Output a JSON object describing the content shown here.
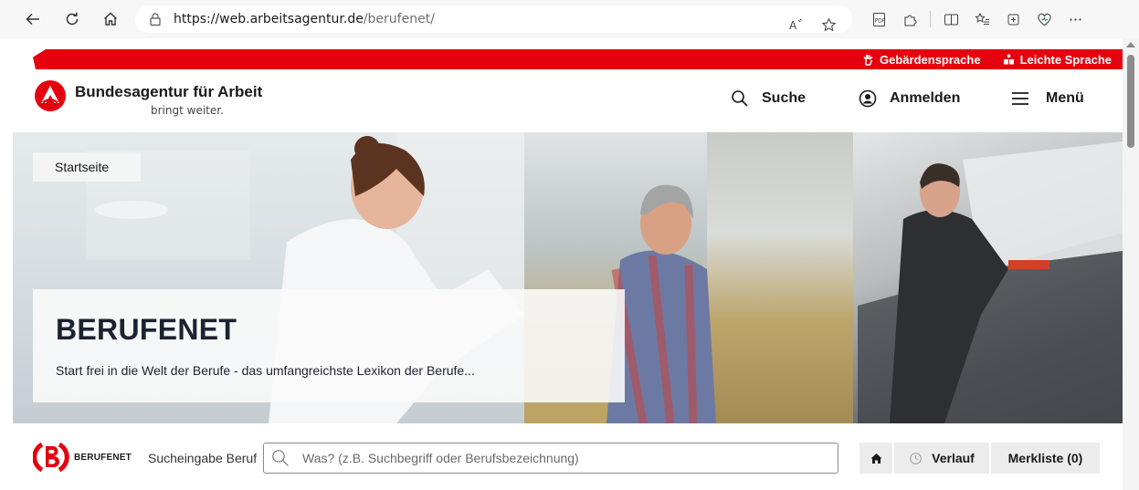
{
  "browser": {
    "url_domain": "https://web.arbeitsagentur.de",
    "url_path": "/berufenet/"
  },
  "accessibility_bar": {
    "sign_language": "Gebärdensprache",
    "easy_language": "Leichte Sprache"
  },
  "header": {
    "brand_title": "Bundesagentur für Arbeit",
    "brand_slogan": "bringt weiter.",
    "search_label": "Suche",
    "login_label": "Anmelden",
    "menu_label": "Menü"
  },
  "hero": {
    "breadcrumb": "Startseite",
    "title": "BERUFENET",
    "description": "Start frei in die Welt der Berufe - das umfangreichste Lexikon der Berufe..."
  },
  "search_strip": {
    "logo_label": "BERUFENET",
    "field_label": "Sucheingabe Beruf",
    "placeholder": "Was? (z.B. Suchbegriff oder Berufsbezeichnung)",
    "history_label": "Verlauf",
    "watchlist_label": "Merkliste (0)"
  },
  "colors": {
    "brand_red": "#e4000f",
    "text_dark": "#1d2230",
    "button_gray": "#ececec"
  }
}
